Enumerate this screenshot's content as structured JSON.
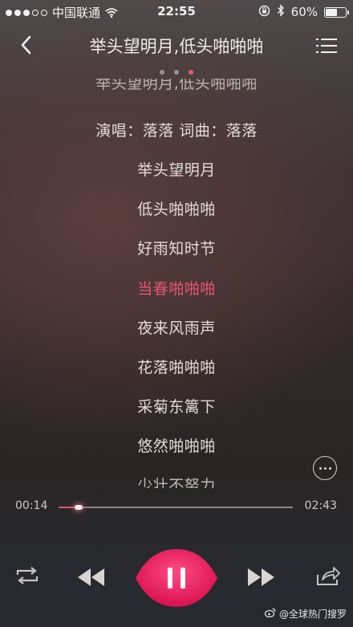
{
  "status_bar": {
    "carrier": "中国联通",
    "time": "22:55",
    "battery_percent": "60%",
    "battery_level": 0.6,
    "signal_bars_filled": 3,
    "signal_bars_total": 5
  },
  "header": {
    "title": "举头望明月,低头啪啪啪"
  },
  "pager": {
    "count": 3,
    "active_index": 2
  },
  "lyrics": {
    "partial_top": "举头望明月,低头啪啪啪",
    "credits": "演唱：落落 词曲：落落",
    "lines": [
      "举头望明月",
      "低头啪啪啪",
      "好雨知时节",
      "当春啪啪啪",
      "夜来风雨声",
      "花落啪啪啪",
      "采菊东篱下",
      "悠然啪啪啪"
    ],
    "current_index": 3,
    "partial_bottom": "少壮不努力"
  },
  "player": {
    "elapsed": "00:14",
    "total": "02:43",
    "progress": 0.086
  },
  "icons": {
    "back": "chevron-left-icon",
    "playlist": "playlist-icon",
    "more": "more-dots-icon",
    "repeat": "repeat-icon",
    "previous": "previous-icon",
    "pause": "pause-icon",
    "next": "next-icon",
    "share": "share-icon"
  },
  "colors": {
    "accent": "#e8566f",
    "play_button": "#e3195a"
  },
  "watermark": {
    "text": "@全球热门搜罗"
  }
}
